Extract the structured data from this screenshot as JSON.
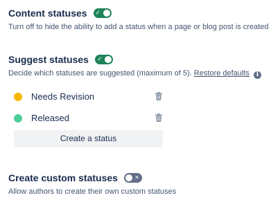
{
  "content_statuses": {
    "title": "Content statuses",
    "enabled": true,
    "toggle_mark": "✓",
    "description": "Turn off to hide the ability to add a status when a page or blog post is created"
  },
  "suggest_statuses": {
    "title": "Suggest statuses",
    "enabled": true,
    "toggle_mark": "✓",
    "description": "Decide which statuses are suggested (maximum of 5).",
    "restore_link": "Restore defaults",
    "info_icon": "i",
    "items": [
      {
        "label": "Needs Revision",
        "color": "#f5b800",
        "icon": "trash-icon"
      },
      {
        "label": "Released",
        "color": "#4bce97",
        "icon": "trash-icon"
      }
    ],
    "create_button": "Create a status"
  },
  "custom_statuses": {
    "title": "Create custom statuses",
    "enabled": false,
    "toggle_mark": "✕",
    "description": "Allow authors to create their own custom statuses"
  }
}
